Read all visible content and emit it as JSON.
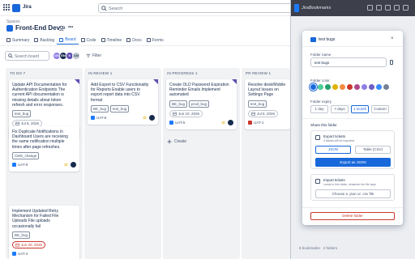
{
  "app": {
    "name": "Jira"
  },
  "topbar": {
    "search_placeholder": "Search"
  },
  "project": {
    "breadcrumb": "Spaces",
    "title": "Front-End Dev",
    "more": "•••"
  },
  "tabs": [
    {
      "label": "Summary",
      "active": false
    },
    {
      "label": "Backlog",
      "active": false
    },
    {
      "label": "Board",
      "active": true
    },
    {
      "label": "Code",
      "active": false
    },
    {
      "label": "Timeline",
      "active": false
    },
    {
      "label": "Docs",
      "active": false
    },
    {
      "label": "Forms",
      "active": false
    }
  ],
  "board": {
    "search_placeholder": "Search board",
    "filter_label": "Filter",
    "avatars": [
      {
        "initials": "DS",
        "color": "#8f7ee7"
      },
      {
        "initials": "EN",
        "color": "#172b4d"
      },
      {
        "initials": "K",
        "color": "#5e4db2"
      },
      {
        "initials": "AM",
        "color": "#c1c7d0"
      }
    ]
  },
  "columns": [
    {
      "title": "TO DO 7",
      "cards": [
        {
          "title": "Update API Documentation for Authentication Endpoints The current API documentation is missing details about token refresh and error responses.",
          "labels": [
            "test_bug"
          ],
          "date": "Jul 8, 2026",
          "key": "UAT-5",
          "type": "story",
          "overdue": false
        },
        {
          "title": "Fix Duplicate Notifications in Dashboard Users are receiving the same notification multiple times after page refreshes.",
          "labels": [
            "CMS_change"
          ],
          "date": "",
          "key": "UAT-9",
          "type": "story",
          "overdue": false
        },
        {
          "title": "Implement Updated Retry Mechanism for Failed File Uploads File uploads occasionally fail",
          "labels": [
            "BE_bug"
          ],
          "date": "Jun 20, 2026",
          "key": "UAT-4",
          "type": "story",
          "overdue": true
        }
      ]
    },
    {
      "title": "IN REVIEW 1",
      "cards": [
        {
          "title": "Add Export to CSV Functionality for Reports Enable users to export report data into CSV format",
          "labels": [
            "BE_bug",
            "test_bug"
          ],
          "date": "",
          "key": "UAT-8",
          "type": "story",
          "overdue": false
        }
      ]
    },
    {
      "title": "IN PROGRESS 1",
      "create_label": "Create",
      "cards": [
        {
          "title": "Create OLD Password Expiration Reminder Emails Implement automated",
          "labels": [
            "BE_bug",
            "prod_bug"
          ],
          "date": "Jun 10, 2026",
          "key": "UAT-5",
          "type": "story",
          "overdue": false
        }
      ]
    },
    {
      "title": "PR REVIEW 1",
      "cards": [
        {
          "title": "Resolve desk/Mobile Layout Issues on Settings Page",
          "labels": [
            "test_bug"
          ],
          "date": "Jul 5, 2026",
          "key": "UAT-1",
          "type": "bug",
          "overdue": false
        }
      ]
    }
  ],
  "extension": {
    "title": "JiraBookmarks",
    "footer": "8 bookmarks · 2 folders"
  },
  "modal": {
    "title": "test bugs",
    "close": "×",
    "folder_name_label": "Folder name",
    "folder_name_value": "test bugs",
    "folder_color_label": "Folder color",
    "colors": [
      "#1868db",
      "#4bce97",
      "#22a06b",
      "#e2b203",
      "#f38a3f",
      "#c9372c",
      "#ae4787",
      "#8f7ee7",
      "#6e5dc6",
      "#388bff",
      "#758195"
    ],
    "folder_expiry_label": "Folder expiry",
    "expiry_options": [
      {
        "label": "1 day",
        "active": false
      },
      {
        "label": "7 days",
        "active": false
      },
      {
        "label": "1 month",
        "active": true
      },
      {
        "label": "Custom",
        "active": false
      }
    ],
    "share_title": "Share this folder",
    "export_title": "Export tickets",
    "export_sub": "3 tickets will be exported",
    "format_json": "JSON",
    "format_csv": "Table (CSV)",
    "export_button": "Export as JSON",
    "import_title": "Import tickets",
    "import_sub": "Lands in this folder, whatever the file says",
    "import_button": "Choose a .json or .csv file",
    "delete_button": "Delete folder"
  }
}
